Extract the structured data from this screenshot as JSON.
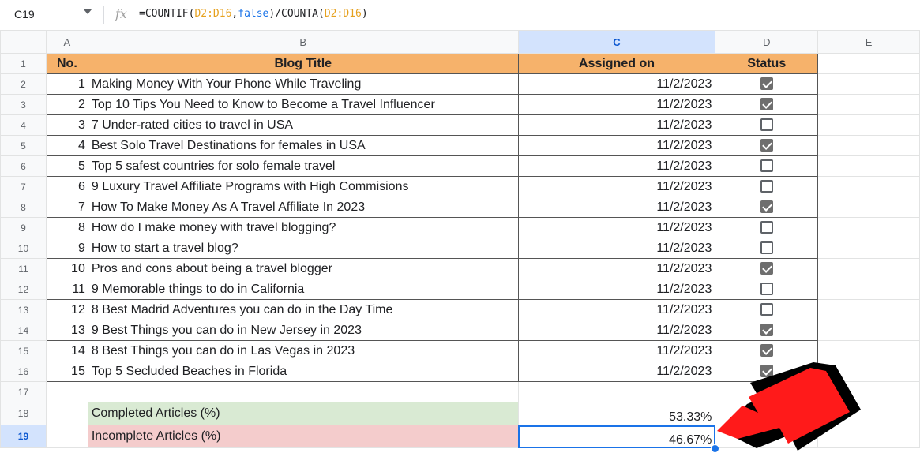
{
  "formula_bar": {
    "cell_ref": "C19",
    "fx": "fx",
    "formula_parts": [
      {
        "t": "=COUNTIF(",
        "c": ""
      },
      {
        "t": "D2:D16",
        "c": "ref"
      },
      {
        "t": ",",
        "c": ""
      },
      {
        "t": "false",
        "c": "kw"
      },
      {
        "t": ")/COUNTA(",
        "c": ""
      },
      {
        "t": "D2:D16",
        "c": "ref"
      },
      {
        "t": ")",
        "c": ""
      }
    ]
  },
  "columns": [
    "A",
    "B",
    "C",
    "D",
    "E"
  ],
  "header_row": {
    "no": "No.",
    "title": "Blog Title",
    "assigned": "Assigned on",
    "status": "Status"
  },
  "rows": [
    {
      "no": "1",
      "title": "Making Money With Your Phone While Traveling",
      "date": "11/2/2023",
      "done": true
    },
    {
      "no": "2",
      "title": "Top 10 Tips You Need to Know to Become a Travel Influencer",
      "date": "11/2/2023",
      "done": true
    },
    {
      "no": "3",
      "title": "7 Under-rated cities to travel in USA",
      "date": "11/2/2023",
      "done": false
    },
    {
      "no": "4",
      "title": "Best Solo Travel Destinations for females in USA",
      "date": "11/2/2023",
      "done": true
    },
    {
      "no": "5",
      "title": "Top 5 safest countries for solo female travel",
      "date": "11/2/2023",
      "done": false
    },
    {
      "no": "6",
      "title": "9 Luxury Travel Affiliate Programs with High Commisions",
      "date": "11/2/2023",
      "done": false
    },
    {
      "no": "7",
      "title": "How To Make Money As A Travel Affiliate In 2023",
      "date": "11/2/2023",
      "done": true
    },
    {
      "no": "8",
      "title": "How do I make money with travel blogging?",
      "date": "11/2/2023",
      "done": false
    },
    {
      "no": "9",
      "title": "How to start a travel blog?",
      "date": "11/2/2023",
      "done": false
    },
    {
      "no": "10",
      "title": "Pros and cons about being a travel blogger",
      "date": "11/2/2023",
      "done": true
    },
    {
      "no": "11",
      "title": "9 Memorable things to do in California",
      "date": "11/2/2023",
      "done": false
    },
    {
      "no": "12",
      "title": "8 Best Madrid Adventures you can do in the Day Time",
      "date": "11/2/2023",
      "done": false
    },
    {
      "no": "13",
      "title": "9 Best Things you can do in New Jersey in 2023",
      "date": "11/2/2023",
      "done": true
    },
    {
      "no": "14",
      "title": "8 Best Things you can do in Las Vegas in 2023",
      "date": "11/2/2023",
      "done": true
    },
    {
      "no": "15",
      "title": "Top 5 Secluded Beaches in Florida",
      "date": "11/2/2023",
      "done": true
    }
  ],
  "summary": {
    "completed_label": "Completed Articles (%)",
    "completed_value": "53.33%",
    "incomplete_label": "Incomplete Articles (%)",
    "incomplete_value": "46.67%"
  },
  "colors": {
    "header_fill": "#f6b26b",
    "completed_fill": "#d9ead3",
    "incomplete_fill": "#f4cccc",
    "arrow": "#ff1a1a"
  }
}
